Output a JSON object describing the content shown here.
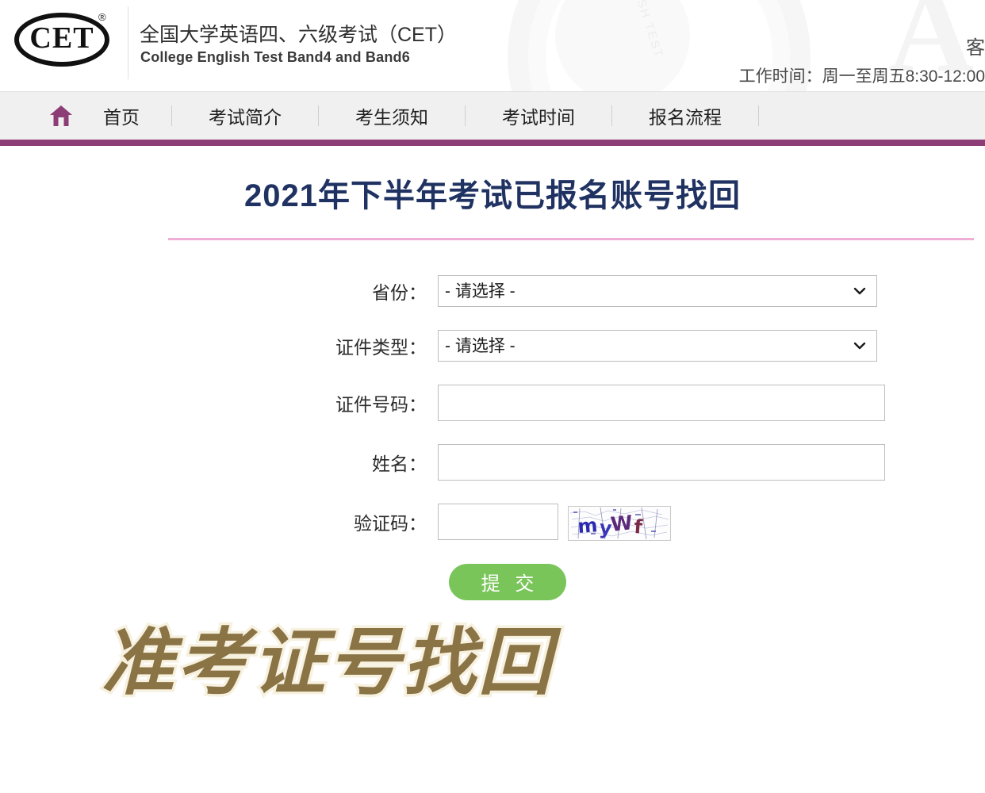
{
  "header": {
    "logo_text": "CET",
    "logo_registered": "®",
    "site_title_cn": "全国大学英语四、六级考试（CET）",
    "site_title_en": "College English Test Band4 and Band6",
    "service_label": "客",
    "work_hours": "工作时间：周一至周五8:30-12:00",
    "watermark_letter": "A",
    "watermark_text": "ENGLISH TEST"
  },
  "nav": {
    "home_icon": "home-icon",
    "items": [
      {
        "label": "首页"
      },
      {
        "label": "考试简介"
      },
      {
        "label": "考生须知"
      },
      {
        "label": "考试时间"
      },
      {
        "label": "报名流程"
      }
    ]
  },
  "main": {
    "page_title": "2021年下半年考试已报名账号找回",
    "form": {
      "rows": [
        {
          "label": "省份：",
          "type": "select",
          "value": "- 请选择 -",
          "options": [
            "- 请选择 -"
          ]
        },
        {
          "label": "证件类型：",
          "type": "select",
          "value": "- 请选择 -",
          "options": [
            "- 请选择 -"
          ]
        },
        {
          "label": "证件号码：",
          "type": "text",
          "value": "",
          "placeholder": ""
        },
        {
          "label": "姓名：",
          "type": "text",
          "value": "",
          "placeholder": ""
        },
        {
          "label": "验证码：",
          "type": "captcha",
          "value": "",
          "placeholder": "",
          "captcha_text": "myWf"
        }
      ],
      "submit_label": "提 交"
    }
  },
  "overlay": {
    "text": "准考证号找回"
  },
  "colors": {
    "nav_underline": "#8d3d76",
    "nav_background": "#f0f0f0",
    "title_color": "#1f3262",
    "title_divider": "#eeaed5",
    "submit_button": "#7ac55a",
    "home_icon": "#8d3d76",
    "overlay_fill": "#8a7344",
    "overlay_stroke": "#f7f1e0"
  }
}
